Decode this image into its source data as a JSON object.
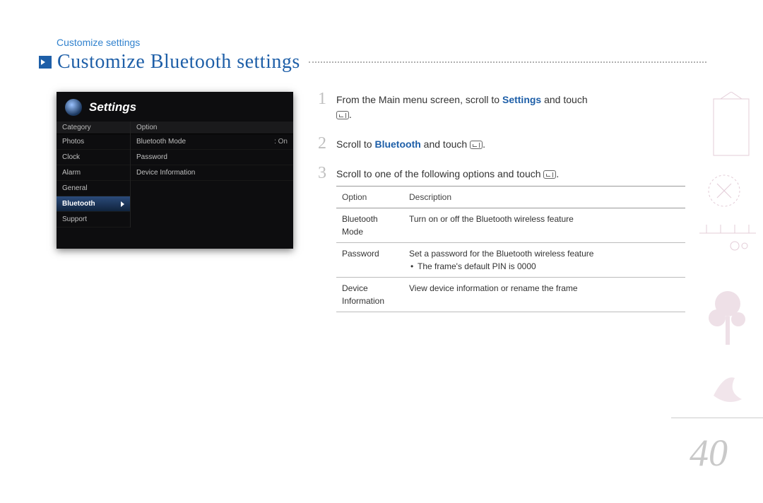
{
  "breadcrumb": "Customize settings",
  "page_title": "Customize Bluetooth settings",
  "page_number": "40",
  "screenshot": {
    "title": "Settings",
    "left_header": "Category",
    "right_header": "Option",
    "categories": [
      "Photos",
      "Clock",
      "Alarm",
      "General",
      "Bluetooth",
      "Support"
    ],
    "active_index": 4,
    "options": [
      {
        "label": "Bluetooth Mode",
        "value": ": On"
      },
      {
        "label": "Password",
        "value": ""
      },
      {
        "label": "Device Information",
        "value": ""
      }
    ]
  },
  "steps": {
    "s1_a": "From the Main menu screen, scroll to ",
    "s1_hl": "Settings",
    "s1_b": " and touch ",
    "s2_a": "Scroll to ",
    "s2_hl": "Bluetooth",
    "s2_b": " and touch ",
    "s3": "Scroll to one of the following options and touch "
  },
  "opt_table": {
    "th_option": "Option",
    "th_desc": "Description",
    "rows": [
      {
        "name": "Bluetooth Mode",
        "desc": "Turn on or off the Bluetooth wireless feature"
      },
      {
        "name": "Password",
        "desc": "Set a password for the Bluetooth wireless feature",
        "bullet": "The frame's default PIN is 0000"
      },
      {
        "name": "Device Information",
        "desc": "View device information or rename the frame"
      }
    ]
  },
  "nums": {
    "n1": "1",
    "n2": "2",
    "n3": "3"
  },
  "period": "."
}
